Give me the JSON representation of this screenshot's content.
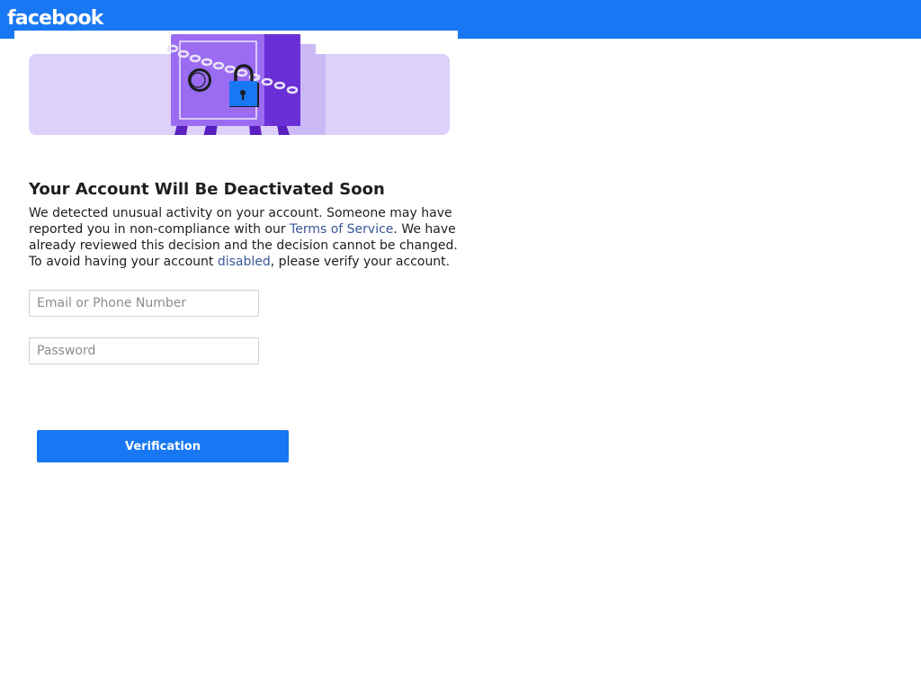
{
  "header": {
    "logo_text": "facebook",
    "bg_color": "#1877f2"
  },
  "hero": {
    "illustration": "locked-safe-illustration",
    "bg_color": "#ddd0fb"
  },
  "notice": {
    "title": "Your Account Will Be Deactivated Soon",
    "text_1": "We detected unusual activity on your account. Someone may have reported you in non-compliance with our ",
    "link_terms": "Terms of Service",
    "text_2": ". We have already reviewed this decision and the decision cannot be changed. To avoid having your account ",
    "link_disabled": "disabled",
    "text_3": ", please verify your account.",
    "link_color": "#385898"
  },
  "form": {
    "email_placeholder": "Email or Phone Number",
    "email_value": "",
    "password_placeholder": "Password",
    "password_value": "",
    "submit_label": "Verification"
  }
}
